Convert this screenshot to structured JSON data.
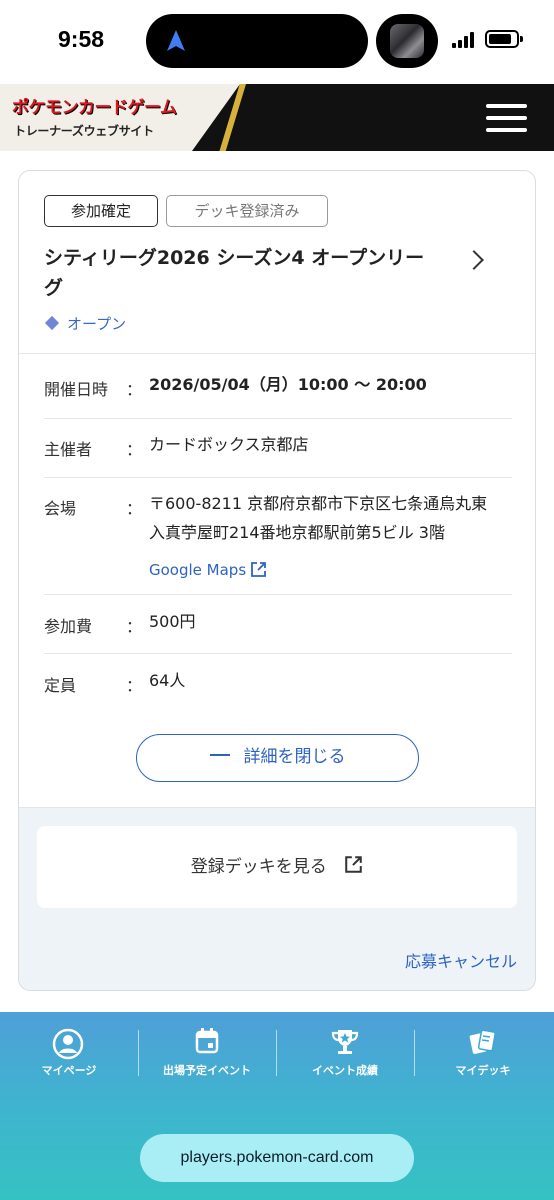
{
  "status_bar": {
    "time": "9:58"
  },
  "header": {
    "logo_title": "ポケモンカードゲーム",
    "logo_subtitle": "トレーナーズウェブサイト",
    "menu_icon": "hamburger-icon"
  },
  "event": {
    "tags": [
      "参加確定",
      "デッキ登録済み"
    ],
    "title": "シティリーグ2026 シーズン4 オープンリーグ",
    "category": "オープン",
    "details": {
      "date_label": "開催日時",
      "date_value": "2026/05/04（月）10:00 〜 20:00",
      "organizer_label": "主催者",
      "organizer_value": "カードボックス京都店",
      "venue_label": "会場",
      "venue_value": "〒600-8211 京都府京都市下京区七条通烏丸東入真苧屋町214番地京都駅前第5ビル 3階",
      "maps_link": "Google Maps",
      "fee_label": "参加費",
      "fee_value": "500円",
      "capacity_label": "定員",
      "capacity_value": "64人",
      "separator": "："
    },
    "close_details_label": "詳細を閉じる",
    "view_deck_label": "登録デッキを見る",
    "cancel_label": "応募キャンセル"
  },
  "bottom_nav": {
    "items": [
      {
        "label": "マイページ",
        "icon": "user-icon"
      },
      {
        "label": "出場予定イベント",
        "icon": "calendar-icon"
      },
      {
        "label": "イベント成績",
        "icon": "trophy-icon"
      },
      {
        "label": "マイデッキ",
        "icon": "cards-icon"
      }
    ]
  },
  "browser": {
    "url": "players.pokemon-card.com"
  },
  "colors": {
    "accent": "#2e63c3",
    "header_bg": "#111111",
    "nav_gradient_top": "#4f9fd8",
    "nav_gradient_bottom": "#35c2c2"
  }
}
